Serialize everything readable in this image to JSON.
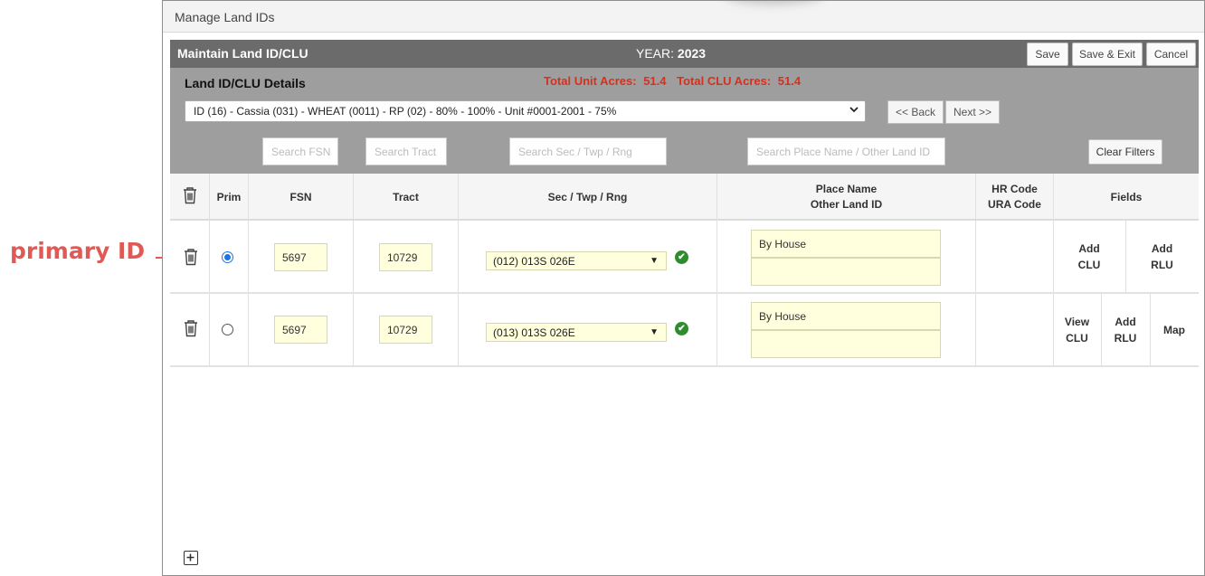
{
  "annotation": {
    "label": "primary ID",
    "color": "#e05a55"
  },
  "window": {
    "title": "Manage Land IDs"
  },
  "header": {
    "title": "Maintain Land ID/CLU",
    "year_label": "YEAR:",
    "year_value": "2023",
    "save": "Save",
    "save_exit": "Save & Exit",
    "cancel": "Cancel"
  },
  "details": {
    "label": "Land ID/CLU Details",
    "total_unit_label": "Total Unit Acres:",
    "total_unit_value": "51.4",
    "total_clu_label": "Total CLU Acres:",
    "total_clu_value": "51.4",
    "selected": "ID (16) - Cassia (031) - WHEAT (0011) - RP (02) - 80% - 100% - Unit #0001-2001 - 75%",
    "back": "<< Back",
    "next": "Next >>"
  },
  "filters": {
    "fsn": "Search FSN",
    "tract": "Search Tract",
    "sec": "Search Sec / Twp / Rng",
    "place": "Search Place Name / Other Land ID",
    "clear": "Clear Filters"
  },
  "columns": {
    "prim": "Prim",
    "fsn": "FSN",
    "tract": "Tract",
    "sec": "Sec / Twp / Rng",
    "place_line1": "Place Name",
    "place_line2": "Other Land ID",
    "hr_line1": "HR Code",
    "hr_line2": "URA Code",
    "fields": "Fields"
  },
  "rows": [
    {
      "primary": true,
      "fsn": "5697",
      "tract": "10729",
      "sec": "(012) 013S 026E",
      "place_name": "By House",
      "other_land_id": "",
      "actions": [
        {
          "line1": "Add",
          "line2": "CLU"
        },
        {
          "line1": "Add",
          "line2": "RLU"
        }
      ]
    },
    {
      "primary": false,
      "fsn": "5697",
      "tract": "10729",
      "sec": "(013) 013S 026E",
      "place_name": "By House",
      "other_land_id": "",
      "actions": [
        {
          "line1": "View",
          "line2": "CLU"
        },
        {
          "line1": "Add",
          "line2": "RLU"
        },
        {
          "line1": "Map",
          "line2": ""
        }
      ]
    }
  ],
  "icons": {
    "delete": "trash-icon",
    "valid": "check-circle-icon",
    "add": "plus-square-icon"
  },
  "colors": {
    "header_bg": "#6b6b6b",
    "panel_bg": "#9e9e9e",
    "totals": "#d6301e",
    "input_bg": "#ffffdd",
    "valid": "#2e8b2e",
    "radio": "#1a73e8"
  }
}
